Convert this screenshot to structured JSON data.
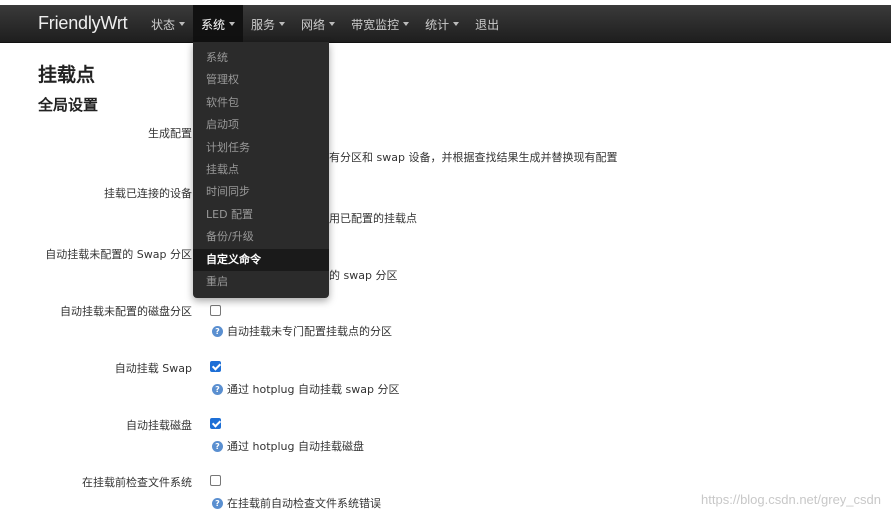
{
  "brand": "FriendlyWrt",
  "nav": [
    {
      "label": "状态",
      "caret": true
    },
    {
      "label": "系统",
      "caret": true
    },
    {
      "label": "服务",
      "caret": true
    },
    {
      "label": "网络",
      "caret": true
    },
    {
      "label": "带宽监控",
      "caret": true
    },
    {
      "label": "统计",
      "caret": true
    },
    {
      "label": "退出",
      "caret": false
    }
  ],
  "dropdown": [
    "系统",
    "管理权",
    "软件包",
    "启动项",
    "计划任务",
    "挂载点",
    "时间同步",
    "LED 配置",
    "备份/升级",
    "自定义命令",
    "重启"
  ],
  "page_title": "挂载点",
  "section_title": "全局设置",
  "rows": {
    "generate_config": {
      "label": "生成配置",
      "desc": "有分区和 swap 设备，并根据查找结果生成并替换现有配置"
    },
    "mount_connected": {
      "label": "挂载已连接的设备",
      "desc": "用已配置的挂载点"
    },
    "auto_swap_unconfigured": {
      "label": "自动挂载未配置的 Swap 分区",
      "desc": "的 swap 分区"
    },
    "auto_mount_unconfigured": {
      "label": "自动挂载未配置的磁盘分区",
      "desc": "自动挂载未专门配置挂载点的分区",
      "checked": false
    },
    "auto_swap": {
      "label": "自动挂载 Swap",
      "desc": "通过 hotplug 自动挂载 swap 分区",
      "checked": true
    },
    "auto_mount": {
      "label": "自动挂载磁盘",
      "desc": "通过 hotplug 自动挂载磁盘",
      "checked": true
    },
    "fsck": {
      "label": "在挂载前检查文件系统",
      "desc": "在挂载前自动检查文件系统错误",
      "checked": false
    }
  },
  "help_icon_glyph": "?",
  "watermark": "https://blog.csdn.net/grey_csdn",
  "colors": {
    "navbar": "#2a2a2a",
    "checkbox_checked": "#1d6fd6",
    "help_icon": "#5a8fd0"
  }
}
